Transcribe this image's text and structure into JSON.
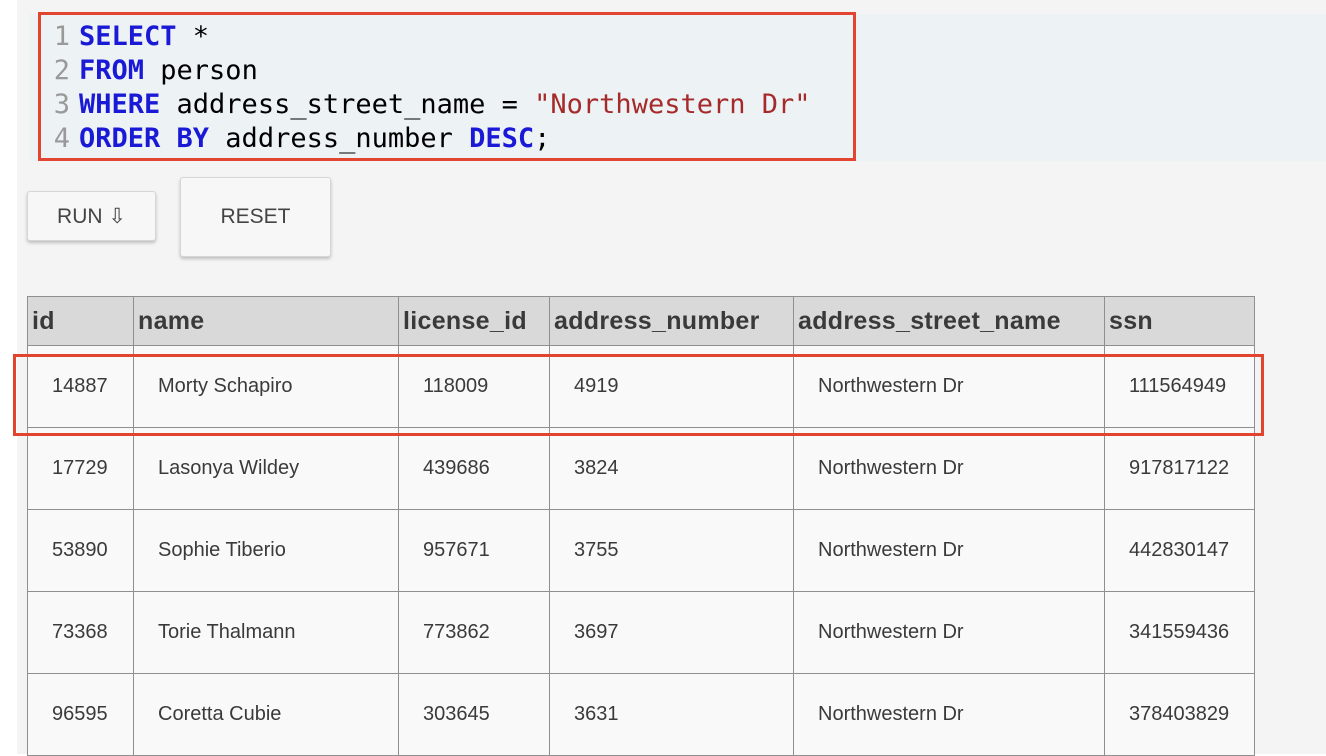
{
  "editor": {
    "line_numbers": [
      "1",
      "2",
      "3",
      "4"
    ],
    "lines": [
      [
        {
          "t": "SELECT",
          "c": "kw"
        },
        {
          "t": " *",
          "c": ""
        }
      ],
      [
        {
          "t": "FROM",
          "c": "kw"
        },
        {
          "t": " person",
          "c": ""
        }
      ],
      [
        {
          "t": "WHERE",
          "c": "kw"
        },
        {
          "t": " address_street_name = ",
          "c": ""
        },
        {
          "t": "\"Northwestern Dr\"",
          "c": "str"
        }
      ],
      [
        {
          "t": "ORDER BY",
          "c": "kw"
        },
        {
          "t": " address_number ",
          "c": ""
        },
        {
          "t": "DESC",
          "c": "kw"
        },
        {
          "t": ";",
          "c": ""
        }
      ]
    ]
  },
  "buttons": {
    "run_label": "RUN ⇩",
    "reset_label": "RESET"
  },
  "results": {
    "columns": [
      "id",
      "name",
      "license_id",
      "address_number",
      "address_street_name",
      "ssn"
    ],
    "rows": [
      [
        "14887",
        "Morty Schapiro",
        "118009",
        "4919",
        "Northwestern Dr",
        "111564949"
      ],
      [
        "17729",
        "Lasonya Wildey",
        "439686",
        "3824",
        "Northwestern Dr",
        "917817122"
      ],
      [
        "53890",
        "Sophie Tiberio",
        "957671",
        "3755",
        "Northwestern Dr",
        "442830147"
      ],
      [
        "73368",
        "Torie Thalmann",
        "773862",
        "3697",
        "Northwestern Dr",
        "341559436"
      ],
      [
        "96595",
        "Coretta Cubie",
        "303645",
        "3631",
        "Northwestern Dr",
        "378403829"
      ]
    ]
  },
  "colors": {
    "keyword": "#1a1ad6",
    "string": "#a52a2a",
    "highlight": "#e2452f"
  }
}
